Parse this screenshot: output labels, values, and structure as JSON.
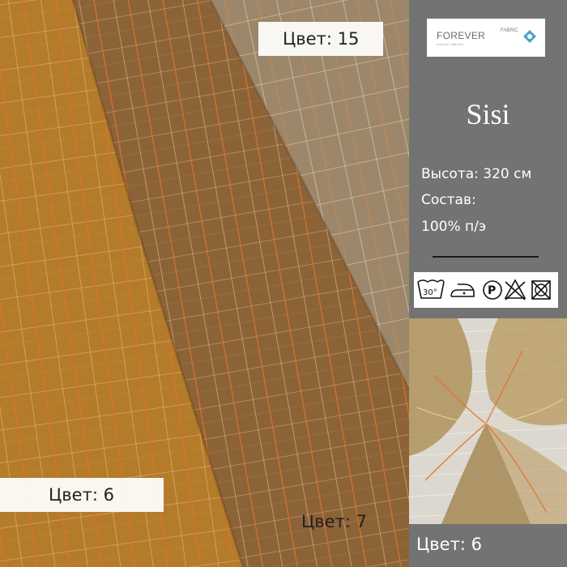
{
  "brand": {
    "logo_main": "FOREVER",
    "logo_sub": "interior fabrics",
    "logo_fabric": "FABRIC"
  },
  "product": {
    "name": "Sisi",
    "height_label": "Высота: 320 см",
    "composition_label": "Состав:",
    "composition_value": "100% п/э"
  },
  "care": {
    "icons": [
      "wash-30-icon",
      "iron-low-icon",
      "dry-clean-p-icon",
      "no-bleach-icon",
      "no-tumble-dry-icon"
    ],
    "wash_temp": "30°"
  },
  "labels": {
    "top": "Цвет: 15",
    "left": "Цвет: 6",
    "bottom_center": "Цвет: 7",
    "thumb": "Цвет: 6"
  },
  "colors": {
    "sidebar_bg": "#747374",
    "fabric_gold": "#b8802c",
    "fabric_brown": "#8a6235",
    "fabric_taupe": "#9e8a6e",
    "accent_orange": "#e0702a"
  }
}
